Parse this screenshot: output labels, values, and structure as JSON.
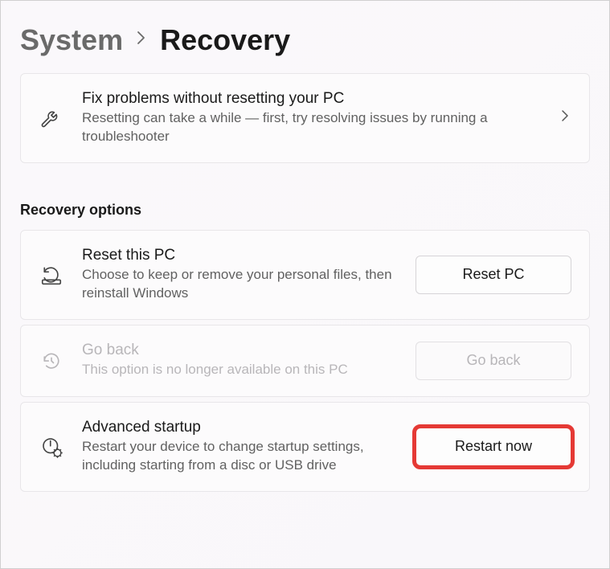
{
  "breadcrumb": {
    "parent": "System",
    "current": "Recovery"
  },
  "troubleshoot": {
    "title": "Fix problems without resetting your PC",
    "desc": "Resetting can take a while — first, try resolving issues by running a troubleshooter"
  },
  "section_heading": "Recovery options",
  "reset": {
    "title": "Reset this PC",
    "desc": "Choose to keep or remove your personal files, then reinstall Windows",
    "button": "Reset PC"
  },
  "goback": {
    "title": "Go back",
    "desc": "This option is no longer available on this PC",
    "button": "Go back"
  },
  "advanced": {
    "title": "Advanced startup",
    "desc": "Restart your device to change startup settings, including starting from a disc or USB drive",
    "button": "Restart now"
  }
}
